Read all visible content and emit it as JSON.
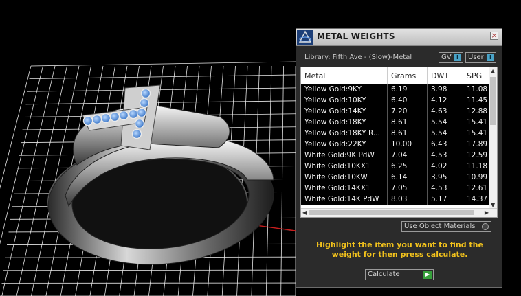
{
  "panel": {
    "title": "METAL WEIGHTS",
    "close_glyph": "×",
    "library": "Library: Fifth Ave - (Slow)-Metal",
    "toggle_gv": "GV",
    "toggle_user": "User",
    "table": {
      "headers": [
        "Metal",
        "Grams",
        "DWT",
        "SPG"
      ],
      "rows": [
        [
          "Yellow Gold:9KY",
          "6.19",
          "3.98",
          "11.08"
        ],
        [
          "Yellow Gold:10KY",
          "6.40",
          "4.12",
          "11.45"
        ],
        [
          "Yellow Gold:14KY",
          "7.20",
          "4.63",
          "12.88"
        ],
        [
          "Yellow Gold:18KY",
          "8.61",
          "5.54",
          "15.41"
        ],
        [
          "Yellow Gold:18KY R...",
          "8.61",
          "5.54",
          "15.41"
        ],
        [
          "Yellow Gold:22KY",
          "10.00",
          "6.43",
          "17.89"
        ],
        [
          "White Gold:9K PdW",
          "7.04",
          "4.53",
          "12.59"
        ],
        [
          "White Gold:10KX1",
          "6.25",
          "4.02",
          "11.18"
        ],
        [
          "White Gold:10KW",
          "6.14",
          "3.95",
          "10.99"
        ],
        [
          "White Gold:14KX1",
          "7.05",
          "4.53",
          "12.61"
        ],
        [
          "White Gold:14K PdW",
          "8.03",
          "5.17",
          "14.37"
        ]
      ]
    },
    "use_object_materials": "Use Object Materials",
    "instruction": "Highlight the item you want to find the weight for then press calculate.",
    "calculate_label": "Calculate"
  },
  "colors": {
    "grid": "#ffffff",
    "axis_x": "#c81e1e",
    "axis_y": "#2aa3a3",
    "gem": "#5d9be6",
    "instruction": "#f2c21c"
  },
  "icons": [
    "app-logo-icon",
    "close-icon",
    "scroll-up-icon",
    "scroll-down-icon",
    "scroll-left-icon",
    "scroll-right-icon",
    "calculate-arrow-icon"
  ]
}
